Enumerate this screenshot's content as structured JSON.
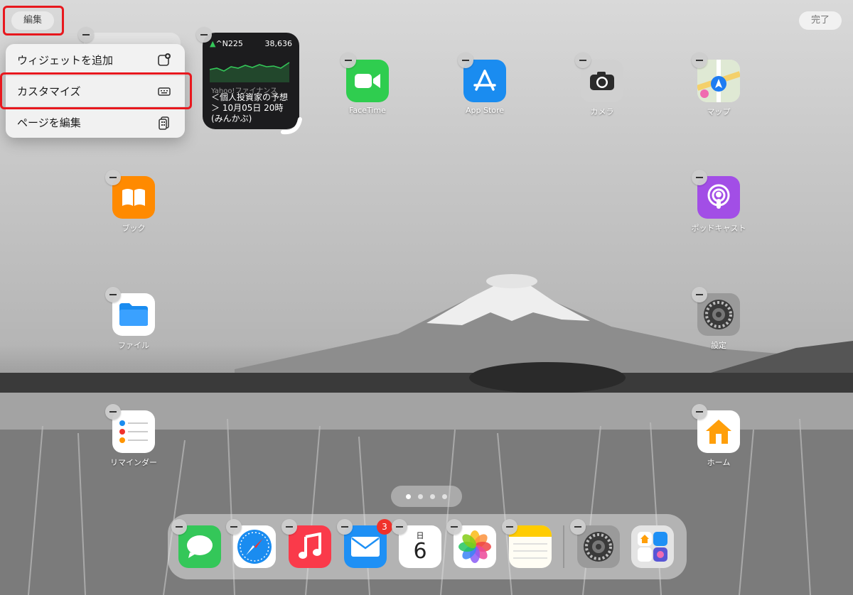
{
  "topbar": {
    "edit_label": "編集",
    "done_label": "完了"
  },
  "context_menu": {
    "items": [
      {
        "label": "ウィジェットを追加",
        "icon": "widget-add-icon"
      },
      {
        "label": "カスタマイズ",
        "icon": "customize-icon"
      },
      {
        "label": "ページを編集",
        "icon": "pages-icon"
      }
    ]
  },
  "stock_widget": {
    "symbol": "^N225",
    "value": "38,636",
    "source": "Yahoo!ファイナンス",
    "headline": "＜個人投資家の予想＞ 10月05日 20時 (みんかぶ)"
  },
  "apps": {
    "facetime": "FaceTime",
    "appstore": "App Store",
    "camera": "カメラ",
    "maps": "マップ",
    "books": "ブック",
    "podcasts": "ポッドキャスト",
    "files": "ファイル",
    "settings": "設定",
    "reminders": "リマインダー",
    "home": "ホーム"
  },
  "dock": {
    "mail_badge": "3",
    "calendar_weekday": "日",
    "calendar_date": "6"
  },
  "highlight_color": "#e8181e"
}
